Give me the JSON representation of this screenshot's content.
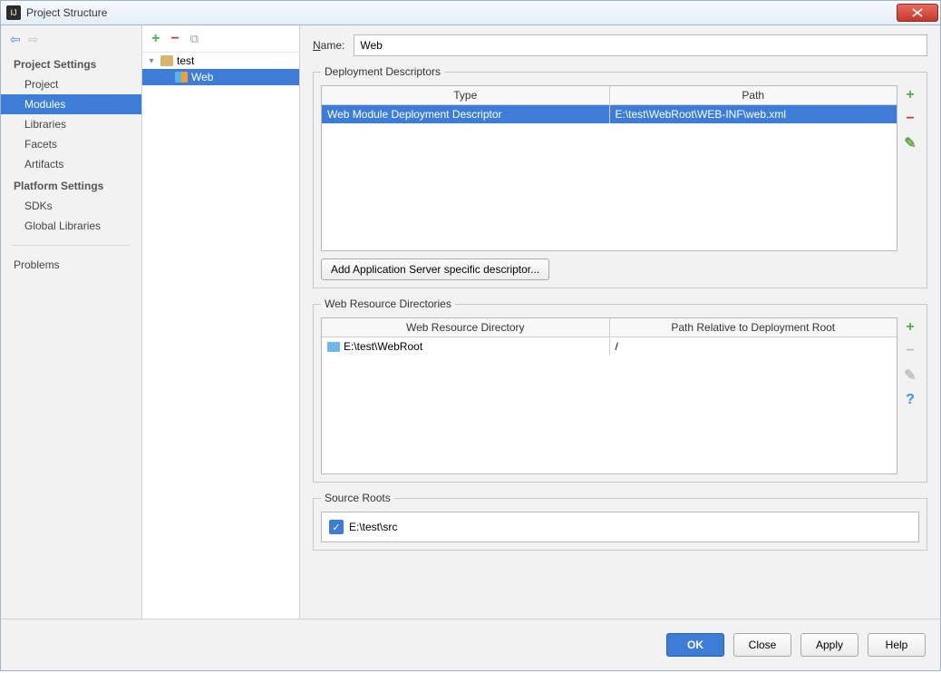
{
  "titlebar": {
    "title": "Project Structure"
  },
  "sidebar": {
    "section1": "Project Settings",
    "items1": [
      "Project",
      "Modules",
      "Libraries",
      "Facets",
      "Artifacts"
    ],
    "section2": "Platform Settings",
    "items2": [
      "SDKs",
      "Global Libraries"
    ],
    "problems": "Problems"
  },
  "tree": {
    "root": "test",
    "child": "Web"
  },
  "content": {
    "name_label_u": "N",
    "name_label_rest": "ame:",
    "name_value": "Web",
    "deploy_legend": "Deployment Descriptors",
    "deploy_headers": [
      "Type",
      "Path"
    ],
    "deploy_row": {
      "type": "Web Module Deployment Descriptor",
      "path": "E:\\test\\WebRoot\\WEB-INF\\web.xml"
    },
    "add_desc_btn_pre": "Add Application ",
    "add_desc_btn_u": "S",
    "add_desc_btn_post": "erver specific descriptor...",
    "webres_legend": "Web Resource Directories",
    "webres_headers": [
      "Web Resource Directory",
      "Path Relative to Deployment Root"
    ],
    "webres_row": {
      "dir": "E:\\test\\WebRoot",
      "path": "/"
    },
    "source_legend": "Source Roots",
    "source_item": "E:\\test\\src"
  },
  "footer": {
    "ok": "OK",
    "close": "Close",
    "apply": "Apply",
    "help": "Help"
  }
}
